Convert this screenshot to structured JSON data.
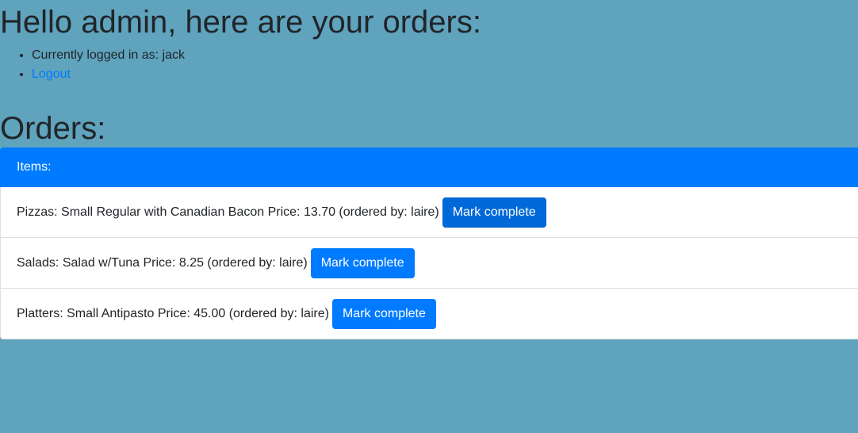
{
  "greeting": "Hello admin, here are your orders:",
  "user_menu": {
    "logged_in_text": "Currently logged in as: jack",
    "logout_label": "Logout"
  },
  "orders_heading": "Orders:",
  "items_header": "Items:",
  "orders": [
    {
      "text": "Pizzas: Small Regular with Canadian Bacon Price: 13.70 (ordered by: laire)",
      "button_label": "Mark complete"
    },
    {
      "text": "Salads: Salad w/Tuna Price: 8.25 (ordered by: laire)",
      "button_label": "Mark complete"
    },
    {
      "text": "Platters: Small Antipasto Price: 45.00 (ordered by: laire)",
      "button_label": "Mark complete"
    }
  ],
  "colors": {
    "background": "#5fa3bd",
    "primary": "#007bff",
    "link": "#007bff"
  }
}
